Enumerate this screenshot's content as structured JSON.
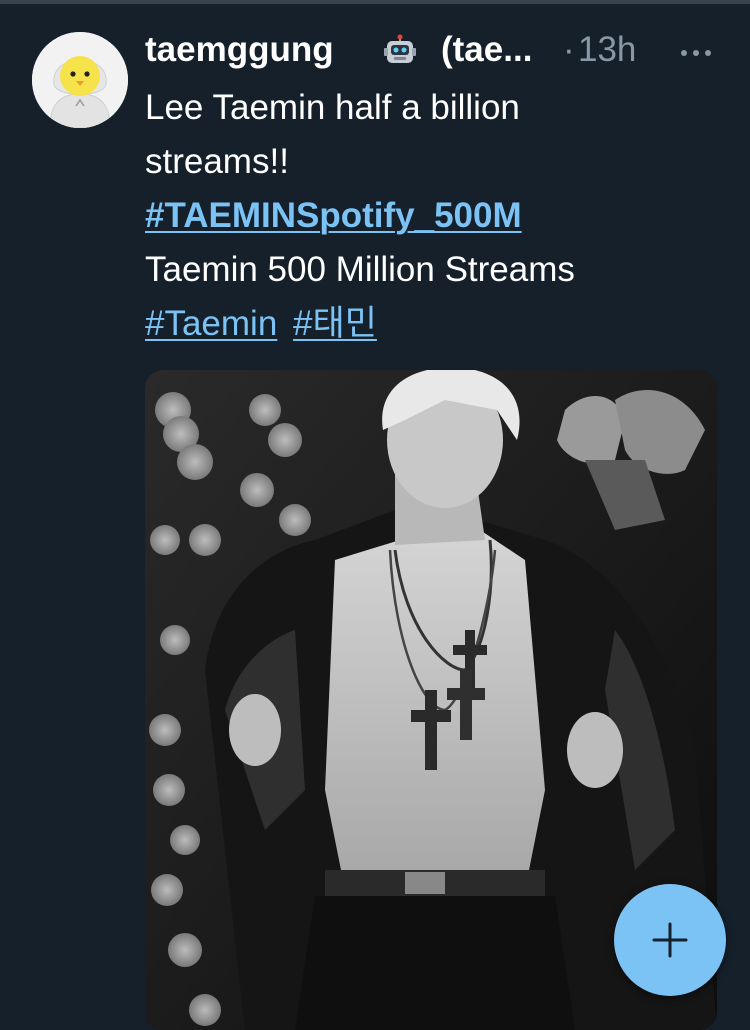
{
  "tweet": {
    "display_name": "taemggung",
    "name_emoji_icon": "robot-face-icon",
    "handle": "(tae...",
    "separator": "·",
    "time": "13h",
    "more_icon": "more-horizontal-icon",
    "text_line1": "Lee Taemin half a billion",
    "text_line2": "streams!!",
    "hashtag1": "#TAEMINSpotify_500M",
    "text_line4": "Taemin 500 Million Streams",
    "hashtag2": "#Taemin",
    "hashtag3": "#태민"
  },
  "media": {
    "type": "photo",
    "style": "black-and-white concert photo"
  },
  "fab": {
    "icon": "plus-icon"
  },
  "colors": {
    "background": "#15202b",
    "link": "#7cc3f5",
    "secondary_text": "#8899a6",
    "fab": "#7cc3f5"
  }
}
